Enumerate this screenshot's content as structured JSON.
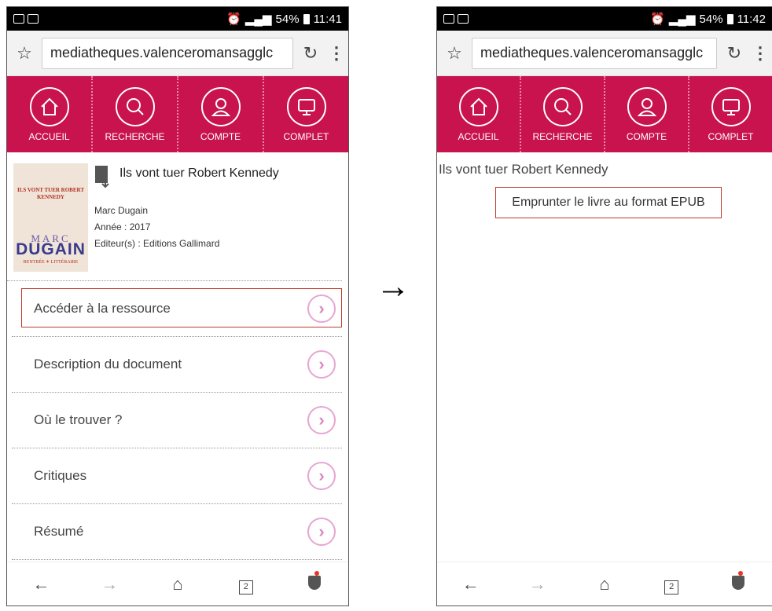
{
  "left": {
    "status": {
      "battery": "54%",
      "time": "11:41"
    },
    "url": "mediatheques.valenceromansagglc",
    "nav": [
      {
        "label": "ACCUEIL",
        "icon": "home-icon"
      },
      {
        "label": "RECHERCHE",
        "icon": "search-icon"
      },
      {
        "label": "COMPTE",
        "icon": "user-icon"
      },
      {
        "label": "COMPLET",
        "icon": "monitor-icon"
      }
    ],
    "book": {
      "title": "Ils vont tuer Robert Kennedy",
      "author": "Marc Dugain",
      "year": "Année : 2017",
      "publisher": "Editeur(s) : Editions Gallimard",
      "cover_title": "ILS VONT TUER ROBERT KENNEDY",
      "cover_author_first": "MARC",
      "cover_author_last": "DUGAIN",
      "cover_band": "RENTRÉE ✶ LITTÉRAIRE"
    },
    "items": [
      {
        "label": "Accéder à la ressource"
      },
      {
        "label": "Description du document"
      },
      {
        "label": "Où le trouver ?"
      },
      {
        "label": "Critiques"
      },
      {
        "label": "Résumé"
      }
    ],
    "bottom": {
      "tabs_count": "2"
    }
  },
  "arrow": "→",
  "right": {
    "status": {
      "battery": "54%",
      "time": "11:42"
    },
    "url": "mediatheques.valenceromansagglc",
    "nav": [
      {
        "label": "ACCUEIL"
      },
      {
        "label": "RECHERCHE"
      },
      {
        "label": "COMPTE"
      },
      {
        "label": "COMPLET"
      }
    ],
    "title": "Ils vont tuer Robert Kennedy",
    "epub_button": "Emprunter le livre au format EPUB",
    "bottom": {
      "tabs_count": "2"
    }
  },
  "colors": {
    "brand": "#c8134e",
    "highlight": "#c0392b",
    "chevron": "#e7a6d1"
  }
}
